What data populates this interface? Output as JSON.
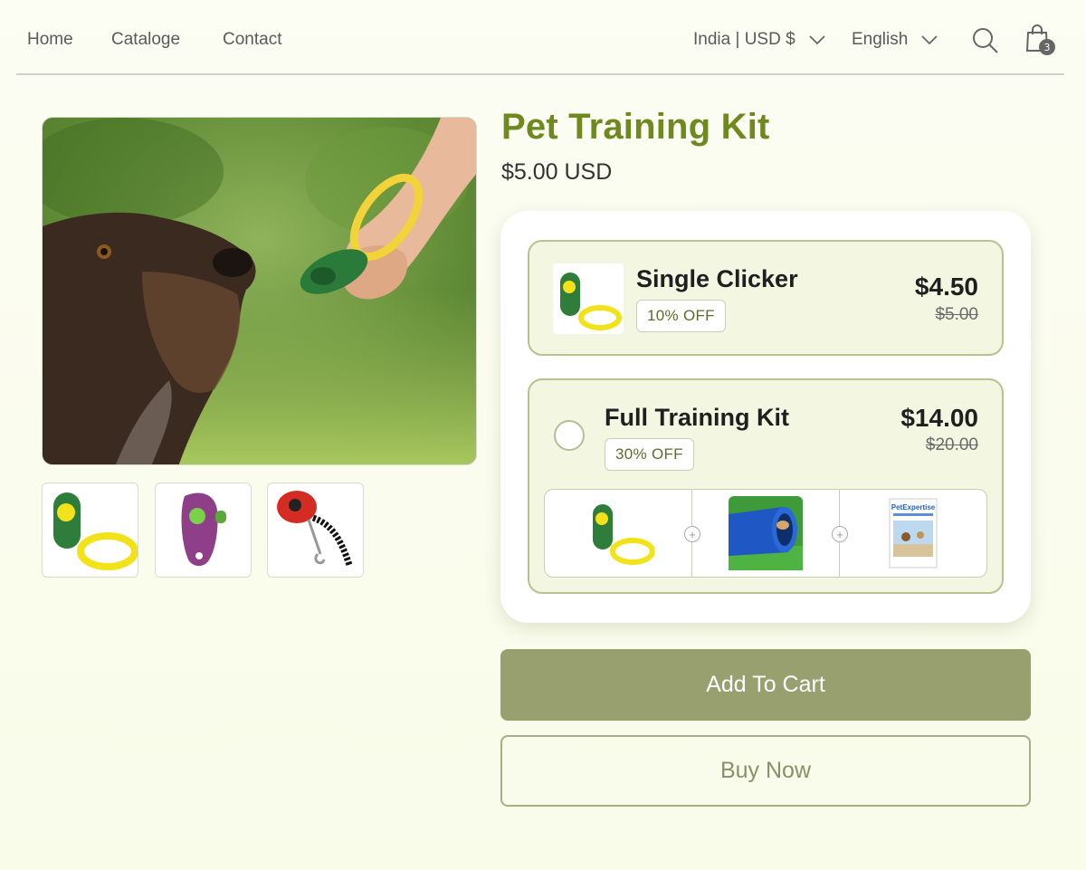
{
  "nav": {
    "links": [
      "Home",
      "Cataloge",
      "Contact"
    ],
    "region": "India | USD $",
    "language": "English",
    "cart_count": "3"
  },
  "product": {
    "title": "Pet Training Kit",
    "price": "$5.00 USD"
  },
  "options": [
    {
      "name": "Single Clicker",
      "discount": "10% OFF",
      "price": "$4.50",
      "old_price": "$5.00"
    },
    {
      "name": "Full Training Kit",
      "discount": "30% OFF",
      "price": "$14.00",
      "old_price": "$20.00",
      "items": [
        "clicker",
        "agility-tunnel",
        "training-guide-book"
      ],
      "book_title": "PetExpertise"
    }
  ],
  "actions": {
    "add_to_cart": "Add To Cart",
    "buy_now": "Buy Now"
  },
  "colors": {
    "title_green": "#6e8a1e",
    "button_olive": "#99a070",
    "option_bg": "#f3f6e1",
    "option_border": "#b7c28f"
  }
}
